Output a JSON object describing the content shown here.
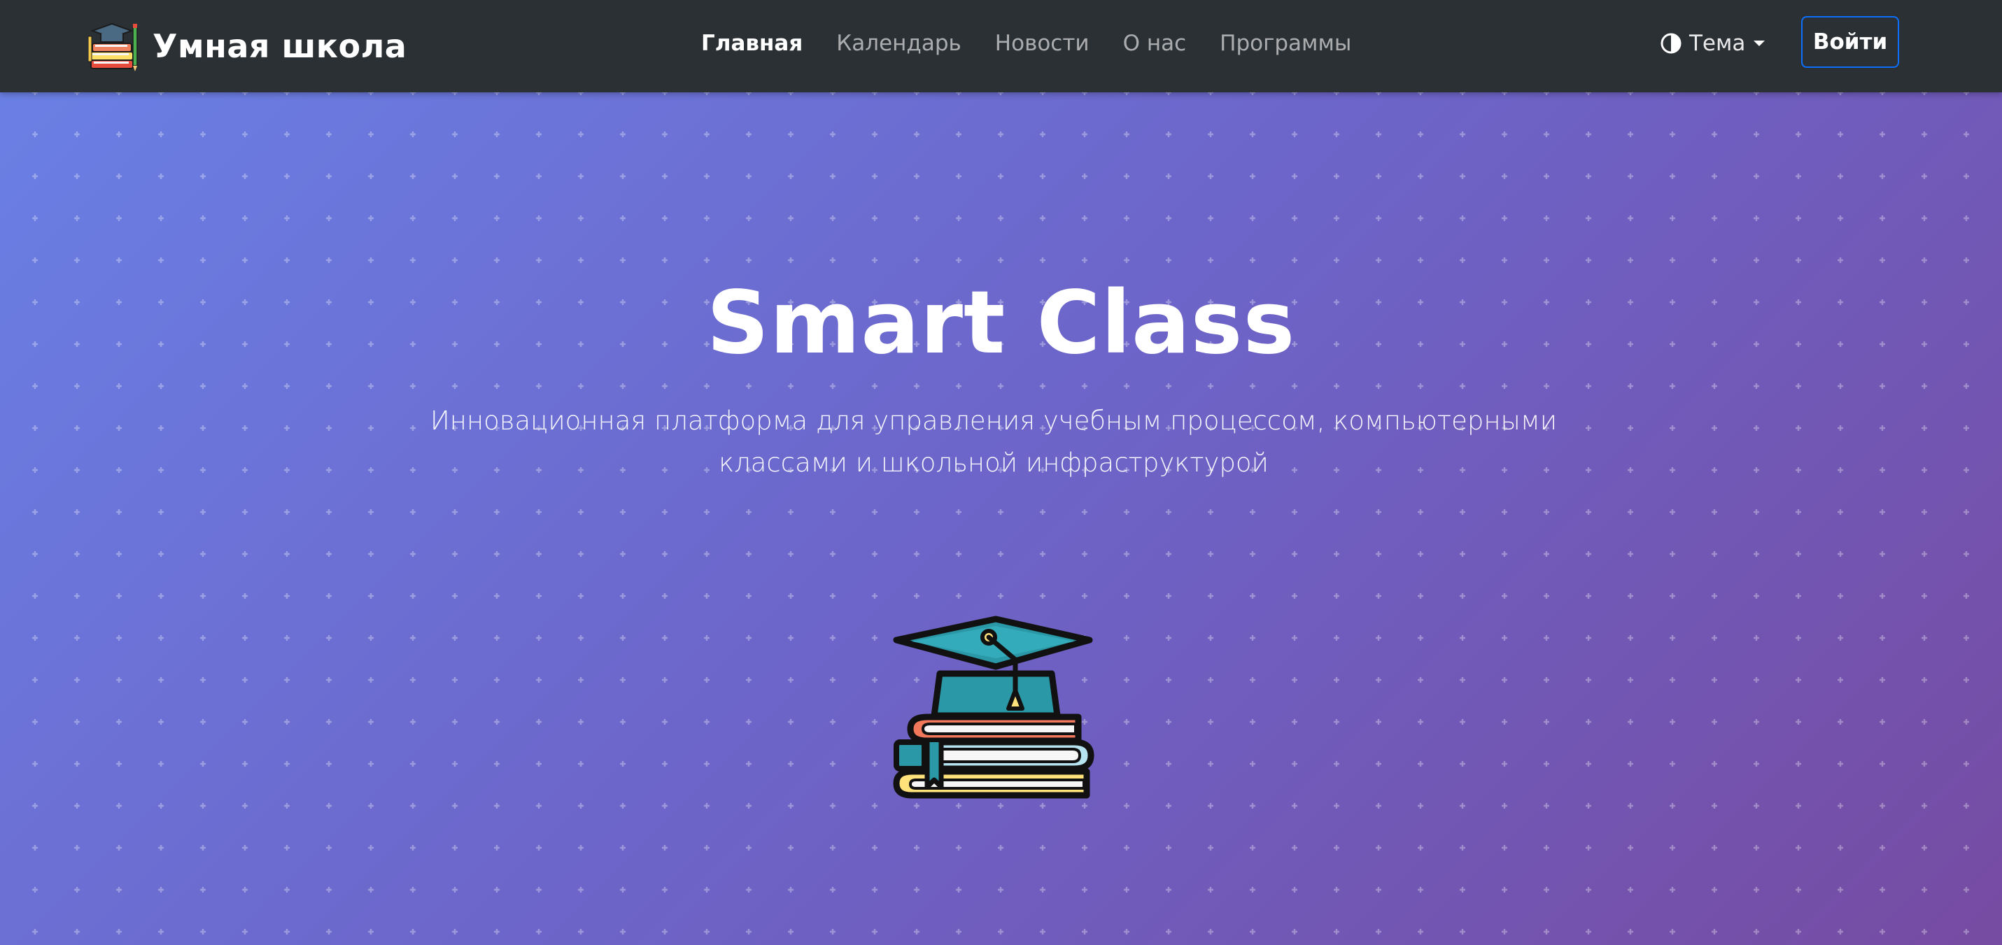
{
  "navbar": {
    "brand": {
      "name": "Умная школа",
      "logo_icon": "school-books-logo-icon"
    },
    "links": [
      {
        "label": "Главная",
        "active": true
      },
      {
        "label": "Календарь",
        "active": false
      },
      {
        "label": "Новости",
        "active": false
      },
      {
        "label": "О нас",
        "active": false
      },
      {
        "label": "Программы",
        "active": false
      }
    ],
    "theme_toggle": {
      "label": "Тема",
      "icon": "contrast-half-circle-icon",
      "caret_icon": "caret-down-icon"
    },
    "login_button": {
      "label": "Войти"
    }
  },
  "hero": {
    "title": "Smart Class",
    "subtitle": "Инновационная платформа для управления учебным процессом, компьютерными классами и школьной инфраструктурой",
    "illustration_icon": "graduation-cap-on-books-icon",
    "background_colors": [
      "#667eea",
      "#764ba2"
    ],
    "pattern_icon": "plus-pattern-icon"
  },
  "colors": {
    "navbar_bg": "#2b3035",
    "login_border": "#0d6efd",
    "cap": "#2a98a6",
    "tassel": "#ffd966",
    "book_red": "#f2785c",
    "book_blue": "#b5e3f0",
    "book_yellow": "#ffe37a"
  }
}
